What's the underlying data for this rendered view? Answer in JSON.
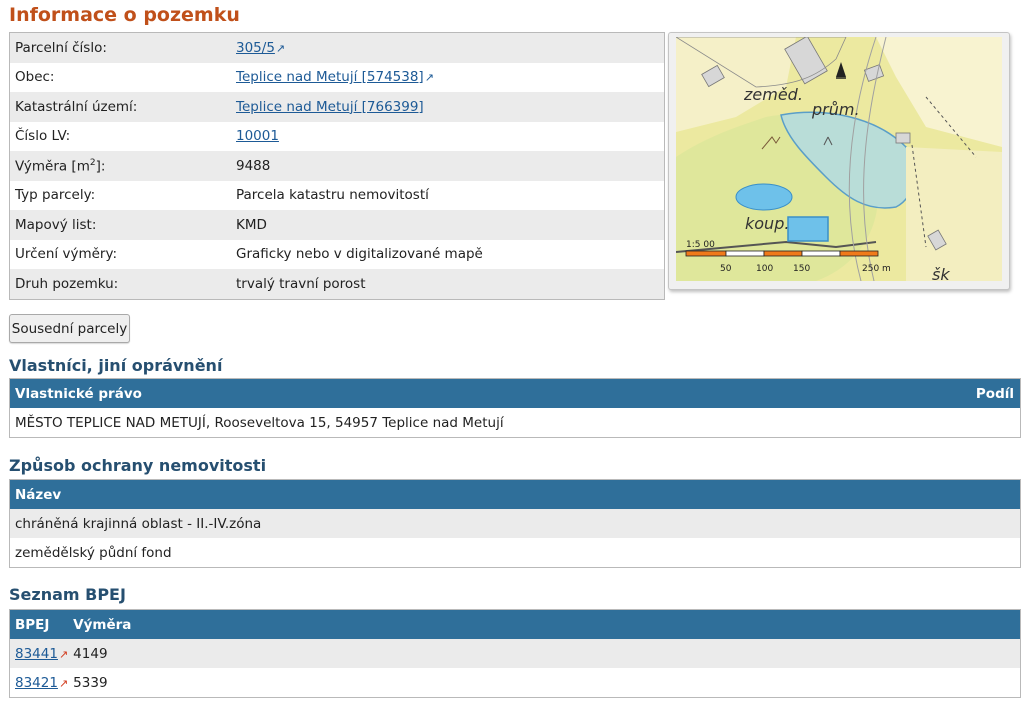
{
  "page_title": "Informace o pozemku",
  "info_rows": [
    {
      "label": "Parcelní číslo:",
      "value": "305/5",
      "link": true,
      "ext": true
    },
    {
      "label": "Obec:",
      "value": "Teplice nad Metují [574538]",
      "link": true,
      "ext": true
    },
    {
      "label": "Katastrální území:",
      "value": "Teplice nad Metují [766399]",
      "link": true,
      "ext": false
    },
    {
      "label": "Číslo LV:",
      "value": "10001",
      "link": true,
      "ext": false
    },
    {
      "label": "Výměra [m²]:",
      "value": "9488",
      "link": false,
      "ext": false
    },
    {
      "label": "Typ parcely:",
      "value": "Parcela katastru nemovitostí",
      "link": false,
      "ext": false
    },
    {
      "label": "Mapový list:",
      "value": "KMD",
      "link": false,
      "ext": false
    },
    {
      "label": "Určení výměry:",
      "value": "Graficky nebo v digitalizované mapě",
      "link": false,
      "ext": false
    },
    {
      "label": "Druh pozemku:",
      "value": "trvalý travní porost",
      "link": false,
      "ext": false
    }
  ],
  "vymera_label_base": "Výměra [m",
  "vymera_label_sup": "2",
  "vymera_label_end": "]:",
  "map": {
    "labels": [
      "zeměd.",
      "prům.",
      "koup.",
      "šk"
    ],
    "scale_prefix": "1:5 00",
    "scale_ticks": [
      "50",
      "100",
      "150",
      "250 m"
    ]
  },
  "neighbors_button": "Sousední parcely",
  "owners": {
    "title": "Vlastníci, jiní oprávnění",
    "col_right": "Vlastnické právo",
    "col_share": "Podíl",
    "rows": [
      "MĚSTO TEPLICE NAD METUJÍ, Rooseveltova 15, 54957 Teplice nad Metují"
    ]
  },
  "protection": {
    "title": "Způsob ochrany nemovitosti",
    "col_name": "Název",
    "rows": [
      "chráněná krajinná oblast - II.-IV.zóna",
      "zemědělský půdní fond"
    ]
  },
  "bpej": {
    "title": "Seznam BPEJ",
    "col_code": "BPEJ",
    "col_area": "Výměra",
    "rows": [
      {
        "code": "83441",
        "area": "4149"
      },
      {
        "code": "83421",
        "area": "5339"
      }
    ]
  },
  "colors": {
    "title": "#c0501a",
    "section_title": "#264f70",
    "table_header": "#2f6f9a",
    "link": "#1d5a96"
  },
  "icons": {
    "external_link": "↗"
  }
}
